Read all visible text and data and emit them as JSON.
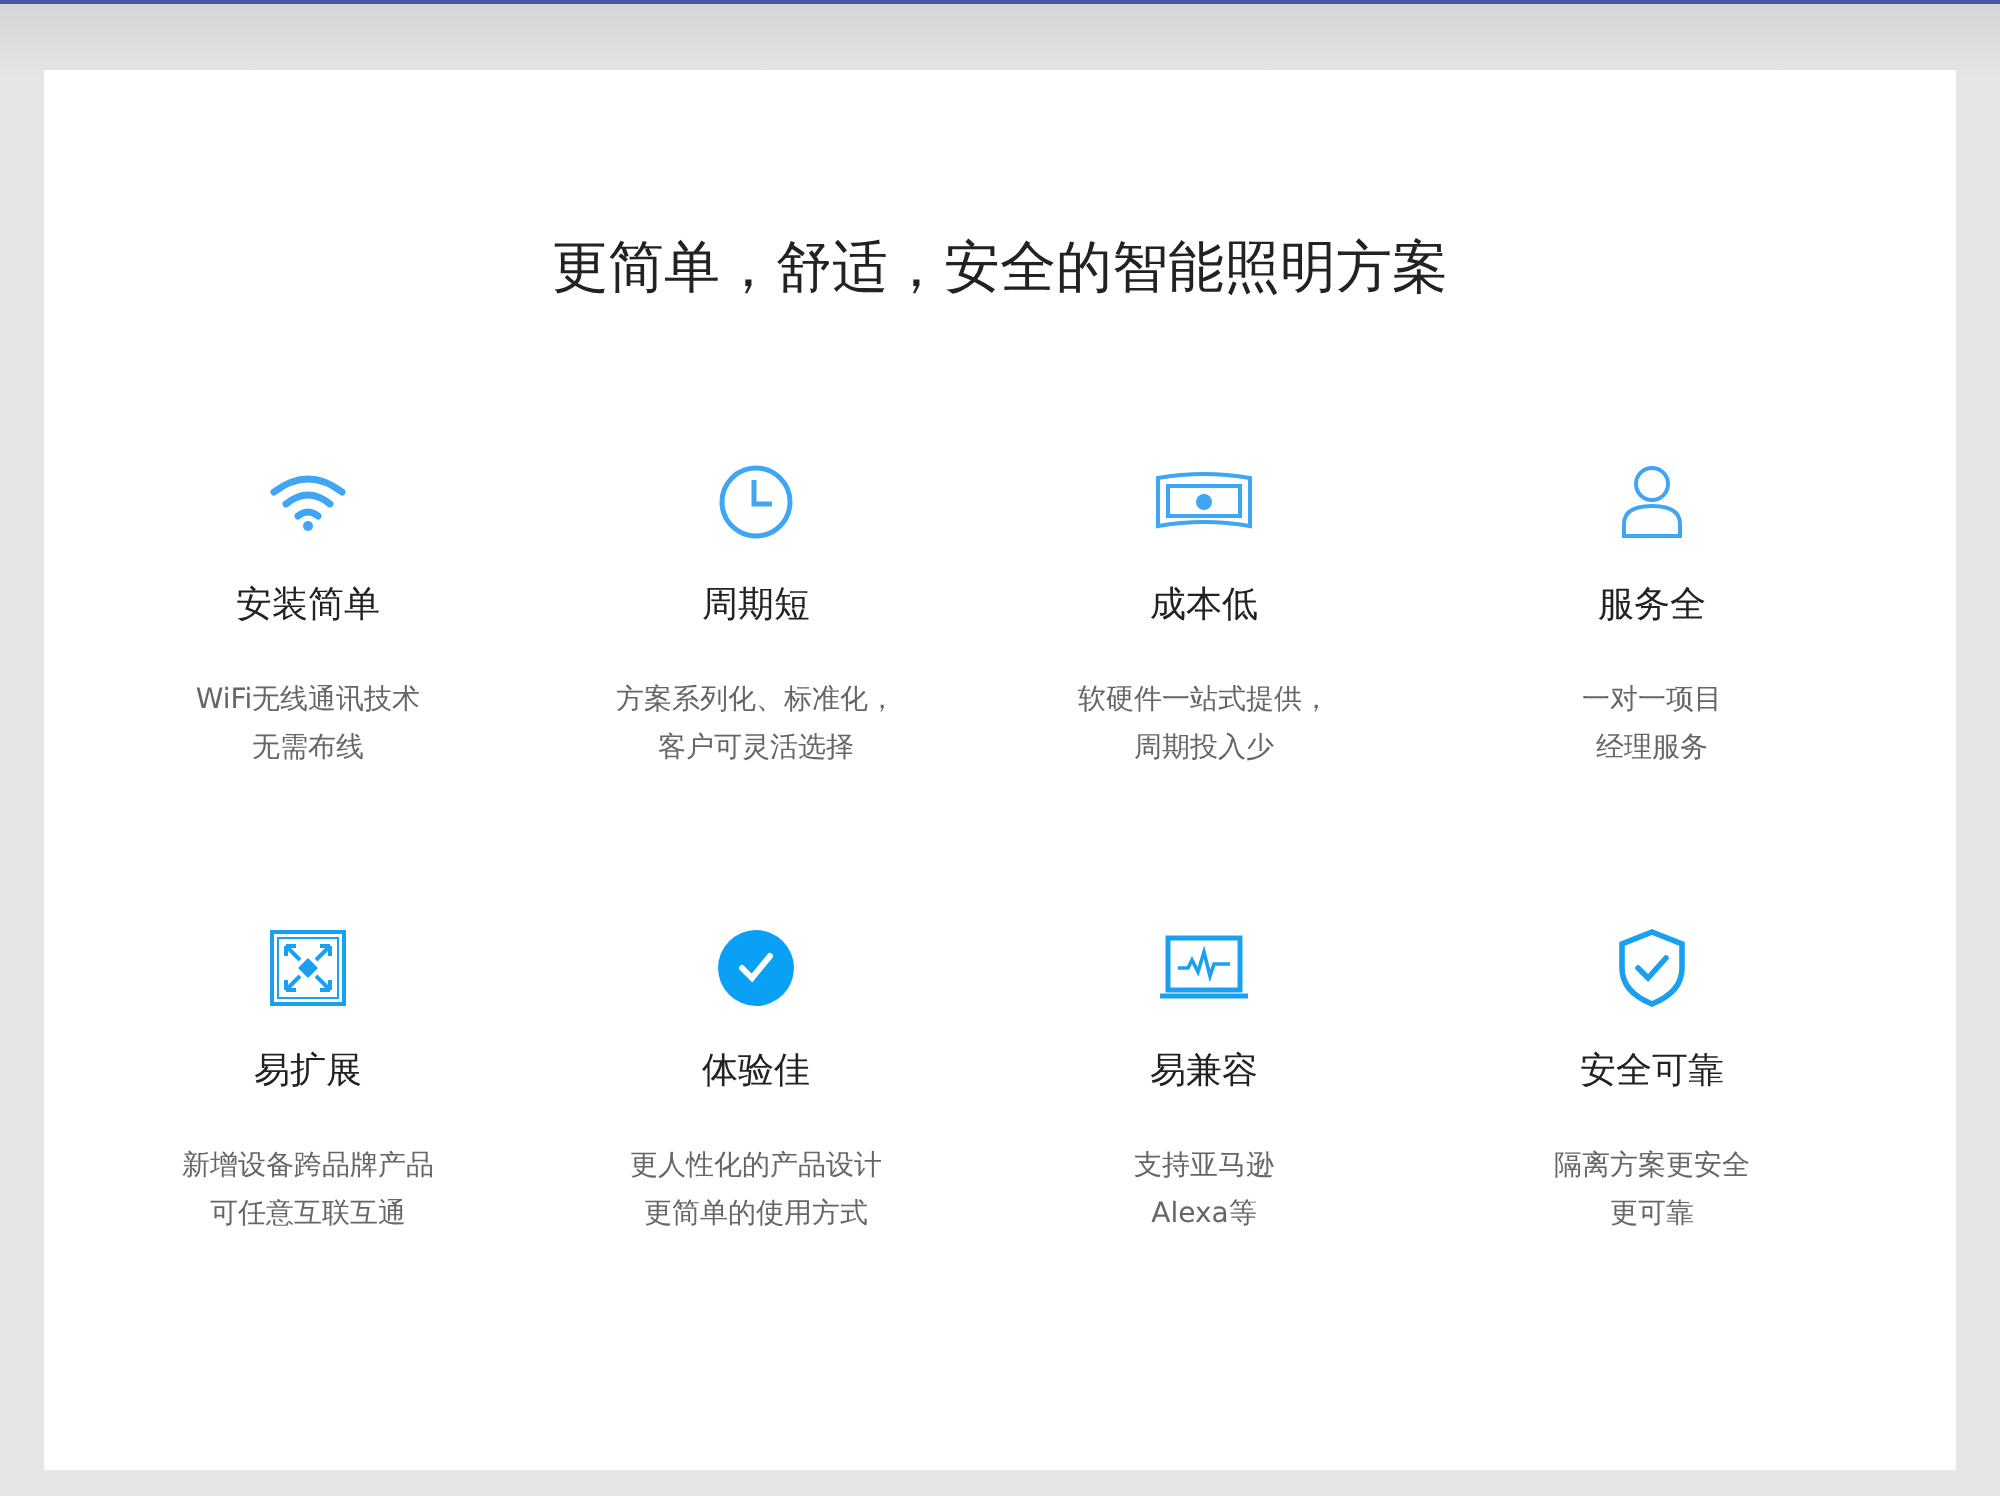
{
  "title": "更简单，舒适，安全的智能照明方案",
  "features": [
    {
      "name": "安装简单",
      "lines": [
        "WiFi无线通讯技术",
        "无需布线"
      ]
    },
    {
      "name": "周期短",
      "lines": [
        "方案系列化、标准化，",
        "客户可灵活选择"
      ]
    },
    {
      "name": "成本低",
      "lines": [
        "软硬件一站式提供，",
        "周期投入少"
      ]
    },
    {
      "name": "服务全",
      "lines": [
        "一对一项目",
        "经理服务"
      ]
    },
    {
      "name": "易扩展",
      "lines": [
        "新增设备跨品牌产品",
        "可任意互联互通"
      ]
    },
    {
      "name": "体验佳",
      "lines": [
        "更人性化的产品设计",
        "更简单的使用方式"
      ]
    },
    {
      "name": "易兼容",
      "lines": [
        "支持亚马逊",
        "Alexa等"
      ]
    },
    {
      "name": "安全可靠",
      "lines": [
        "隔离方案更安全",
        "更可靠"
      ]
    }
  ]
}
